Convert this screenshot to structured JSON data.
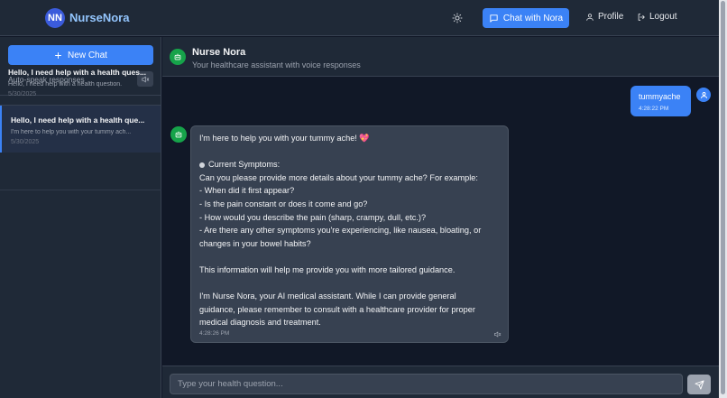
{
  "nav": {
    "logo_text": "NN",
    "brand": "NurseNora",
    "chat_button": "Chat with Nora",
    "profile": "Profile",
    "logout": "Logout"
  },
  "sidebar": {
    "new_chat": "New Chat",
    "auto_speak_label": "Auto-speak responses",
    "chats": [
      {
        "title": "Hello, I need help with a health ques...",
        "preview": "Hello, I need help with a health question.",
        "date": "5/30/2025"
      },
      {
        "title": "Hello, I need help with a health que...",
        "preview": "I'm here to help you with your tummy ach...",
        "date": "5/30/2025"
      }
    ]
  },
  "header": {
    "title": "Nurse Nora",
    "subtitle": "Your healthcare assistant with voice responses"
  },
  "messages": {
    "user": {
      "text": "tummyache",
      "time": "4:28:22 PM"
    },
    "bot": {
      "lines": [
        "I'm here to help you with your tummy ache! 💖",
        "",
        "Current Symptoms:",
        "Can you please provide more details about your tummy ache? For example:",
        "- When did it first appear?",
        "- Is the pain constant or does it come and go?",
        "- How would you describe the pain (sharp, crampy, dull, etc.)?",
        "- Are there any other symptoms you're experiencing, like nausea, bloating, or",
        "changes in your bowel habits?",
        "",
        "This information will help me provide you with more tailored guidance.",
        "",
        "I'm Nurse Nora, your AI medical assistant. While I can provide general",
        "guidance, please remember to consult with a healthcare provider for proper",
        "medical diagnosis and treatment."
      ],
      "time": "4:28:26 PM"
    }
  },
  "input": {
    "placeholder": "Type your health question..."
  },
  "colors": {
    "accent": "#3b82f6",
    "bot_avatar": "#16a34a",
    "background": "#111827",
    "panel": "#1f2937"
  }
}
